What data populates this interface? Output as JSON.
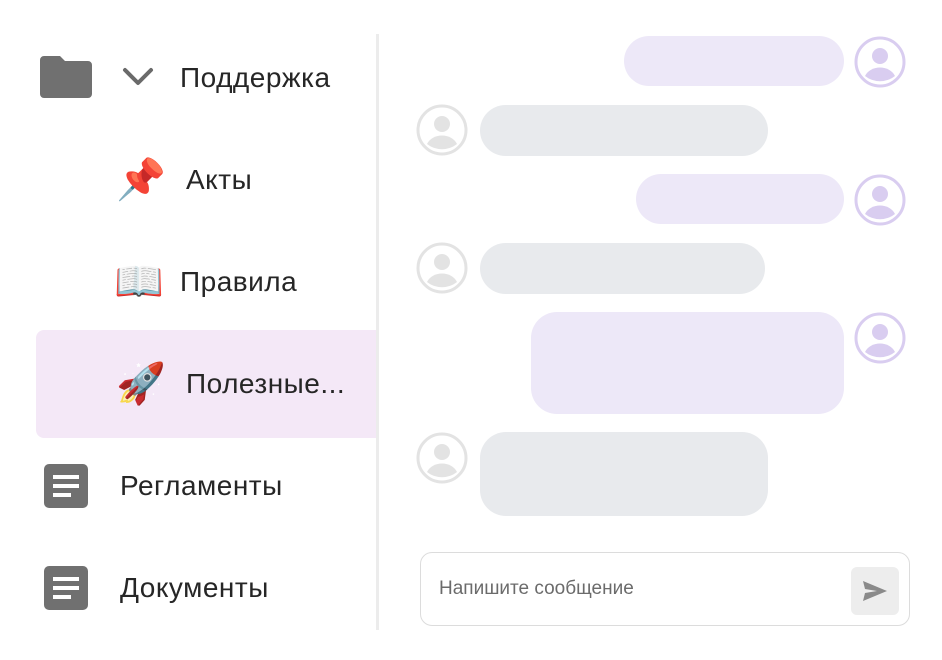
{
  "sidebar": {
    "items": [
      {
        "label": "Поддержка",
        "icon": "folder-icon",
        "expand_icon": "chevron-down-icon"
      },
      {
        "label": "Акты",
        "icon": "pushpin-icon",
        "emoji": "📌"
      },
      {
        "label": "Правила",
        "icon": "open-book-icon",
        "emoji": "📖"
      },
      {
        "label": "Полезные...",
        "icon": "rocket-icon",
        "emoji": "🚀",
        "selected": true
      },
      {
        "label": "Регламенты",
        "icon": "document-icon"
      },
      {
        "label": "Документы",
        "icon": "document-icon"
      }
    ]
  },
  "chat": {
    "messages": [
      {
        "direction": "outgoing",
        "text": ""
      },
      {
        "direction": "incoming",
        "text": ""
      },
      {
        "direction": "outgoing",
        "text": ""
      },
      {
        "direction": "incoming",
        "text": ""
      },
      {
        "direction": "outgoing",
        "text": ""
      },
      {
        "direction": "incoming",
        "text": ""
      }
    ],
    "composer": {
      "placeholder": "Напишите сообщение",
      "value": "",
      "send_icon": "send-icon"
    }
  },
  "colors": {
    "selected_bg": "#f4e8f7",
    "outgoing_bubble": "#ede8f8",
    "incoming_bubble": "#e8eaed",
    "outgoing_avatar": "#d9cdf0",
    "incoming_avatar": "#e3e3e3",
    "icon_gray": "#707070"
  }
}
